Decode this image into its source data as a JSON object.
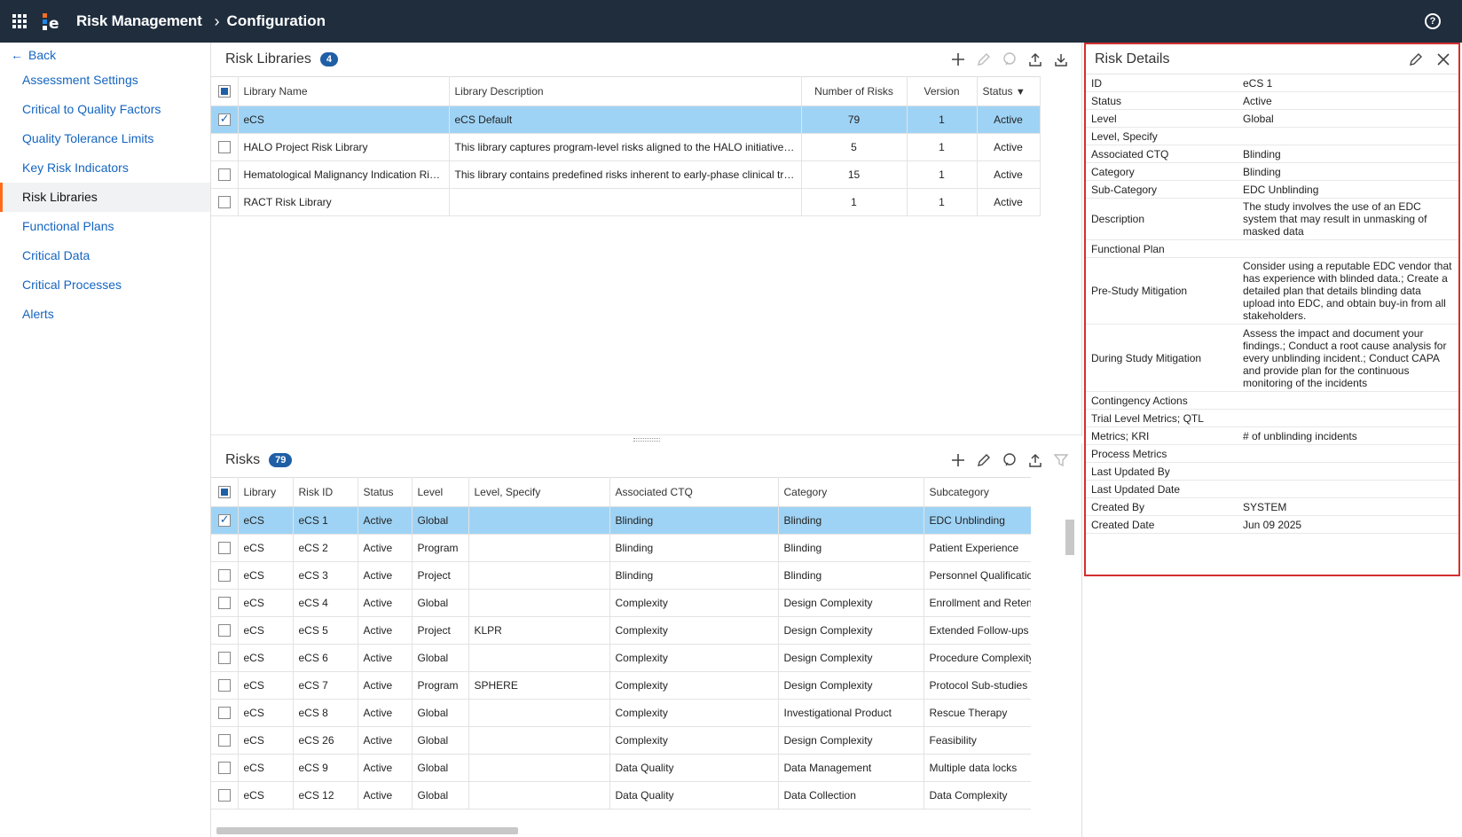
{
  "header": {
    "app_title": "Risk Management",
    "crumb": "Configuration",
    "help": "?"
  },
  "sidebar": {
    "back_label": "Back",
    "items": [
      {
        "label": "Assessment Settings"
      },
      {
        "label": "Critical to Quality Factors"
      },
      {
        "label": "Quality Tolerance Limits"
      },
      {
        "label": "Key Risk Indicators"
      },
      {
        "label": "Risk Libraries"
      },
      {
        "label": "Functional Plans"
      },
      {
        "label": "Critical Data"
      },
      {
        "label": "Critical Processes"
      },
      {
        "label": "Alerts"
      }
    ],
    "active": "Risk Libraries"
  },
  "libraries": {
    "title": "Risk Libraries",
    "count": "4",
    "columns": [
      "Library Name",
      "Library Description",
      "Number of Risks",
      "Version",
      "Status"
    ],
    "rows": [
      {
        "name": "eCS",
        "desc": "eCS Default",
        "risks": "79",
        "version": "1",
        "status": "Active"
      },
      {
        "name": "HALO Project Risk Library",
        "desc": "This library captures program-level risks aligned to the HALO initiative's objectives",
        "risks": "5",
        "version": "1",
        "status": "Active"
      },
      {
        "name": "Hematological Malignancy Indication Risk Library",
        "desc": "This library contains predefined risks inherent to early-phase clinical trials",
        "risks": "15",
        "version": "1",
        "status": "Active"
      },
      {
        "name": "RACT Risk Library",
        "desc": "",
        "risks": "1",
        "version": "1",
        "status": "Active"
      }
    ]
  },
  "risks": {
    "title": "Risks",
    "count": "79",
    "columns": [
      "Library",
      "Risk ID",
      "Status",
      "Level",
      "Level, Specify",
      "Associated CTQ",
      "Category",
      "Subcategory"
    ],
    "rows": [
      {
        "lib": "eCS",
        "id": "eCS 1",
        "status": "Active",
        "level": "Global",
        "spec": "",
        "ctq": "Blinding",
        "cat": "Blinding",
        "sub": "EDC Unblinding"
      },
      {
        "lib": "eCS",
        "id": "eCS 2",
        "status": "Active",
        "level": "Program",
        "spec": "",
        "ctq": "Blinding",
        "cat": "Blinding",
        "sub": "Patient Experience"
      },
      {
        "lib": "eCS",
        "id": "eCS 3",
        "status": "Active",
        "level": "Project",
        "spec": "",
        "ctq": "Blinding",
        "cat": "Blinding",
        "sub": "Personnel Qualification"
      },
      {
        "lib": "eCS",
        "id": "eCS 4",
        "status": "Active",
        "level": "Global",
        "spec": "",
        "ctq": "Complexity",
        "cat": "Design Complexity",
        "sub": "Enrollment and Retention"
      },
      {
        "lib": "eCS",
        "id": "eCS 5",
        "status": "Active",
        "level": "Project",
        "spec": "KLPR",
        "ctq": "Complexity",
        "cat": "Design Complexity",
        "sub": "Extended Follow-ups"
      },
      {
        "lib": "eCS",
        "id": "eCS 6",
        "status": "Active",
        "level": "Global",
        "spec": "",
        "ctq": "Complexity",
        "cat": "Design Complexity",
        "sub": "Procedure Complexity"
      },
      {
        "lib": "eCS",
        "id": "eCS 7",
        "status": "Active",
        "level": "Program",
        "spec": "SPHERE",
        "ctq": "Complexity",
        "cat": "Design Complexity",
        "sub": "Protocol Sub-studies"
      },
      {
        "lib": "eCS",
        "id": "eCS 8",
        "status": "Active",
        "level": "Global",
        "spec": "",
        "ctq": "Complexity",
        "cat": "Investigational Product",
        "sub": "Rescue Therapy"
      },
      {
        "lib": "eCS",
        "id": "eCS 26",
        "status": "Active",
        "level": "Global",
        "spec": "",
        "ctq": "Complexity",
        "cat": "Design Complexity",
        "sub": "Feasibility"
      },
      {
        "lib": "eCS",
        "id": "eCS 9",
        "status": "Active",
        "level": "Global",
        "spec": "",
        "ctq": "Data Quality",
        "cat": "Data Management",
        "sub": "Multiple data locks"
      },
      {
        "lib": "eCS",
        "id": "eCS 12",
        "status": "Active",
        "level": "Global",
        "spec": "",
        "ctq": "Data Quality",
        "cat": "Data Collection",
        "sub": "Data Complexity"
      }
    ]
  },
  "details": {
    "title": "Risk Details",
    "fields": [
      {
        "label": "ID",
        "value": "eCS 1"
      },
      {
        "label": "Status",
        "value": "Active"
      },
      {
        "label": "Level",
        "value": "Global"
      },
      {
        "label": "Level, Specify",
        "value": ""
      },
      {
        "label": "Associated CTQ",
        "value": "Blinding"
      },
      {
        "label": "Category",
        "value": "Blinding"
      },
      {
        "label": "Sub-Category",
        "value": "EDC Unblinding"
      },
      {
        "label": "Description",
        "value": "The study involves the use of an EDC system that may result in unmasking of masked data"
      },
      {
        "label": "Functional Plan",
        "value": ""
      },
      {
        "label": "Pre-Study Mitigation",
        "value": "Consider using a reputable EDC vendor that has experience with blinded data.; Create a detailed plan that details blinding data upload into EDC, and obtain buy-in from all stakeholders."
      },
      {
        "label": "During Study Mitigation",
        "value": "Assess the impact and document your findings.; Conduct a root cause analysis for every unblinding incident.; Conduct CAPA and provide plan for the continuous monitoring of the incidents"
      },
      {
        "label": "Contingency Actions",
        "value": ""
      },
      {
        "label": "Trial Level Metrics; QTL",
        "value": ""
      },
      {
        "label": "Metrics; KRI",
        "value": "# of unblinding incidents"
      },
      {
        "label": "Process Metrics",
        "value": ""
      },
      {
        "label": "Last Updated By",
        "value": ""
      },
      {
        "label": "Last Updated Date",
        "value": ""
      },
      {
        "label": "Created By",
        "value": "SYSTEM"
      },
      {
        "label": "Created Date",
        "value": "Jun 09 2025"
      }
    ]
  }
}
